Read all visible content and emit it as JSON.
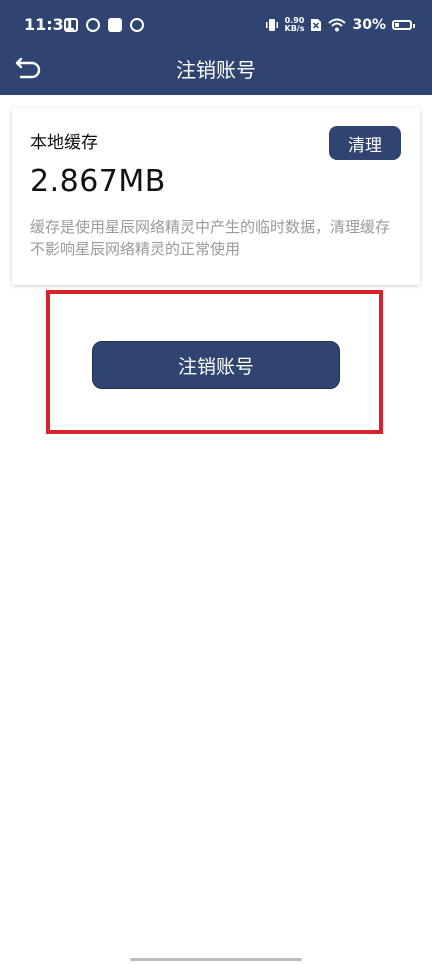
{
  "statusbar": {
    "time": "11:31",
    "net_speed_value": "0.90",
    "net_speed_unit": "KB/s",
    "battery_text": "30%",
    "battery_level": 0.3,
    "icons": [
      "mail-notification-icon",
      "app-notification-icon",
      "app-notification-icon",
      "app-notification-icon",
      "vibrate-icon",
      "sim-disabled-icon",
      "wifi-icon",
      "battery-icon"
    ]
  },
  "header": {
    "title": "注销账号",
    "back_icon": "back-arrow-icon",
    "background_color": "#2f4470"
  },
  "cache_card": {
    "label": "本地缓存",
    "size": "2.867MB",
    "clear_label": "清理",
    "description": "缓存是使用星辰网络精灵中产生的临时数据，清理缓存 不影响星辰网络精灵的正常使用"
  },
  "main": {
    "deactivate_label": "注销账号",
    "highlight_color": "#d9202c"
  }
}
